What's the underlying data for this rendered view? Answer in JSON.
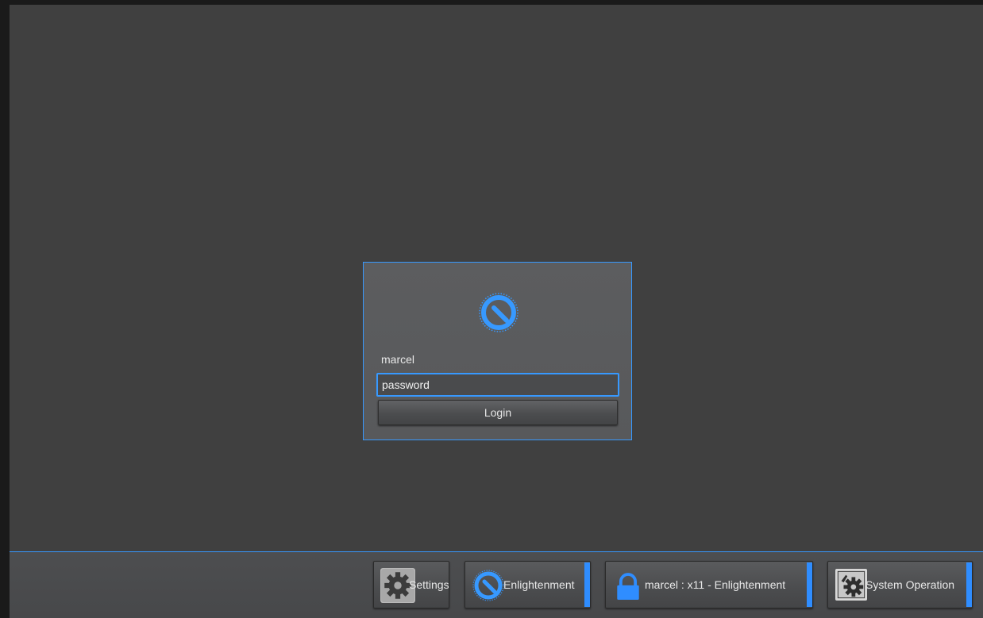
{
  "login": {
    "username": "marcel",
    "password_placeholder": "password",
    "login_label": "Login"
  },
  "shelf": {
    "items": [
      {
        "label": "Settings",
        "icon": "gear-icon"
      },
      {
        "label": "Enlightenment",
        "icon": "enlightenment-logo-icon"
      },
      {
        "label": "marcel : x11 - Enlightenment",
        "icon": "lock-icon"
      },
      {
        "label": "System Operation",
        "icon": "system-operation-icon"
      }
    ]
  },
  "colors": {
    "accent": "#3799ff",
    "background": "#404040",
    "panel": "#58595b",
    "text": "#e8e8e8"
  }
}
